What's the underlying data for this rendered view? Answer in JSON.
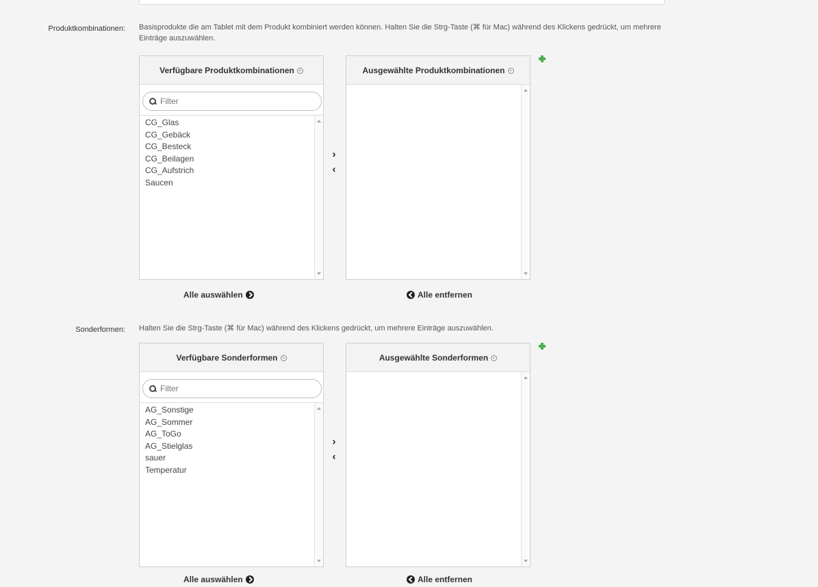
{
  "produktkombinationen": {
    "label": "Produktkombinationen:",
    "help_line1": "Basisprodukte die am Tablet mit dem Produkt kombiniert werden können. Halten Sie die Strg-Taste (⌘ für Mac) während des Klickens gedrückt, um mehrere",
    "help_line2": "Einträge auszuwählen.",
    "available_title": "Verfügbare Produktkombinationen",
    "selected_title": "Ausgewählte Produktkombinationen",
    "filter_placeholder": "Filter",
    "available_items": [
      "CG_Glas",
      "CG_Gebäck",
      "CG_Besteck",
      "CG_Beilagen",
      "CG_Aufstrich",
      "Saucen"
    ],
    "selected_items": [],
    "move_right": "›",
    "move_left": "‹",
    "select_all": "Alle auswählen",
    "remove_all": "Alle entfernen"
  },
  "sonderformen": {
    "label": "Sonderformen:",
    "help_line1": "Halten Sie die Strg-Taste (⌘ für Mac) während des Klickens gedrückt, um mehrere Einträge auszuwählen.",
    "available_title": "Verfügbare Sonderformen",
    "selected_title": "Ausgewählte Sonderformen",
    "filter_placeholder": "Filter",
    "available_items": [
      "AG_Sonstige",
      "AG_Sommer",
      "AG_ToGo",
      "AG_Stielglas",
      "sauer",
      "Temperatur"
    ],
    "selected_items": [],
    "move_right": "›",
    "move_left": "‹",
    "select_all": "Alle auswählen",
    "remove_all": "Alle entfernen"
  },
  "icons": {
    "info": "info-icon",
    "search": "search-icon",
    "add": "plus-icon",
    "select_all": "circle-arrow-right-icon",
    "remove_all": "circle-arrow-left-icon"
  },
  "colors": {
    "background": "#f4f4f4",
    "add_icon": "#4caf50"
  }
}
